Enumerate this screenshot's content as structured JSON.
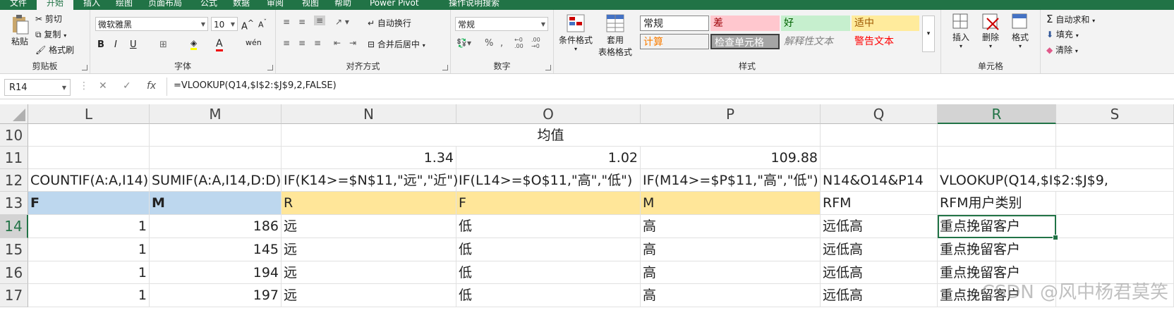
{
  "tabs": [
    "文件",
    "开始",
    "插入",
    "绘图",
    "页面布局",
    "公式",
    "数据",
    "审阅",
    "视图",
    "帮助",
    "Power Pivot",
    "操作说明搜索"
  ],
  "ribbon": {
    "clipboard": {
      "paste": "粘贴",
      "cut": "剪切",
      "copy": "复制",
      "format_painter": "格式刷",
      "label": "剪贴板"
    },
    "font": {
      "name": "微软雅黑",
      "size": "10",
      "bold": "B",
      "italic": "I",
      "underline": "U",
      "label": "字体"
    },
    "alignment": {
      "wrap": "自动换行",
      "merge": "合并后居中",
      "label": "对齐方式"
    },
    "number": {
      "format": "常规",
      "label": "数字"
    },
    "styles": {
      "conditional": "条件格式",
      "table1": "套用",
      "table2": "表格格式",
      "cells": [
        "常规",
        "差",
        "好",
        "适中",
        "计算",
        "检查单元格",
        "解释性文本",
        "警告文本"
      ],
      "label": "样式"
    },
    "cells": {
      "insert": "插入",
      "delete": "删除",
      "format": "格式",
      "label": "单元格"
    },
    "editing": {
      "autosum": "自动求和",
      "fill": "填充",
      "clear": "清除"
    }
  },
  "formula_bar": {
    "name_box": "R14",
    "formula": "=VLOOKUP(Q14,$I$2:$J$9,2,FALSE)"
  },
  "columns": [
    "L",
    "M",
    "N",
    "O",
    "P",
    "Q",
    "R",
    "S"
  ],
  "rows": [
    {
      "num": "10",
      "cells": [
        "",
        "",
        "",
        "均值",
        "",
        "",
        "",
        ""
      ]
    },
    {
      "num": "11",
      "cells": [
        "",
        "",
        "1.34",
        "1.02",
        "109.88",
        "",
        "",
        ""
      ]
    },
    {
      "num": "12",
      "cells": [
        "COUNTIF(A:A,I14)",
        "SUMIF(A:A,I14,D:D)",
        "IF(K14>=$N$11,\"远\",\"近\")",
        "IF(L14>=$O$11,\"高\",\"低\")",
        "IF(M14>=$P$11,\"高\",\"低\")",
        "N14&O14&P14",
        "VLOOKUP(Q14,$I$2:$J$9,",
        ""
      ]
    },
    {
      "num": "13",
      "cells": [
        "F",
        "M",
        "R",
        "F",
        "M",
        "RFM",
        "RFM用户类别",
        ""
      ]
    },
    {
      "num": "14",
      "cells": [
        "1",
        "186",
        "远",
        "低",
        "高",
        "远低高",
        "重点挽留客户",
        ""
      ]
    },
    {
      "num": "15",
      "cells": [
        "1",
        "145",
        "远",
        "低",
        "高",
        "远低高",
        "重点挽留客户",
        ""
      ]
    },
    {
      "num": "16",
      "cells": [
        "1",
        "194",
        "远",
        "低",
        "高",
        "远低高",
        "重点挽留客户",
        ""
      ]
    },
    {
      "num": "17",
      "cells": [
        "1",
        "197",
        "远",
        "低",
        "高",
        "远低高",
        "重点挽留客户",
        ""
      ]
    }
  ],
  "watermark": "CSDN @风中杨君莫笑",
  "colors": {
    "excel_green": "#217346",
    "header_blue": "#bdd7ee",
    "header_yellow": "#ffe699"
  }
}
